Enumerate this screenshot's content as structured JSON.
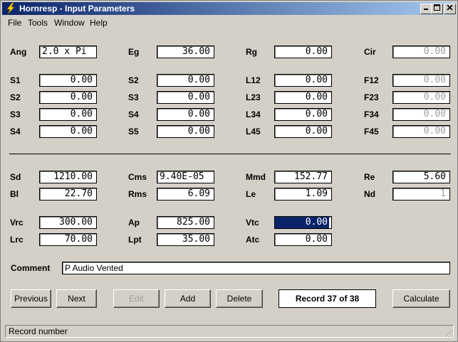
{
  "window": {
    "title": "Hornresp - Input Parameters"
  },
  "menu": [
    "File",
    "Tools",
    "Window",
    "Help"
  ],
  "rows": {
    "r1": [
      {
        "label": "Ang",
        "value": "2.0 x Pi"
      },
      {
        "label": "Eg",
        "value": "36.00"
      },
      {
        "label": "Rg",
        "value": "0.00"
      },
      {
        "label": "Cir",
        "value": "0.00"
      }
    ],
    "r2": [
      {
        "label": "S1",
        "value": "0.00"
      },
      {
        "label": "S2",
        "value": "0.00"
      },
      {
        "label": "L12",
        "value": "0.00"
      },
      {
        "label": "F12",
        "value": "0.00"
      }
    ],
    "r3": [
      {
        "label": "S2",
        "value": "0.00"
      },
      {
        "label": "S3",
        "value": "0.00"
      },
      {
        "label": "L23",
        "value": "0.00"
      },
      {
        "label": "F23",
        "value": "0.00"
      }
    ],
    "r4": [
      {
        "label": "S3",
        "value": "0.00"
      },
      {
        "label": "S4",
        "value": "0.00"
      },
      {
        "label": "L34",
        "value": "0.00"
      },
      {
        "label": "F34",
        "value": "0.00"
      }
    ],
    "r5": [
      {
        "label": "S4",
        "value": "0.00"
      },
      {
        "label": "S5",
        "value": "0.00"
      },
      {
        "label": "L45",
        "value": "0.00"
      },
      {
        "label": "F45",
        "value": "0.00"
      }
    ],
    "r6": [
      {
        "label": "Sd",
        "value": "1210.00"
      },
      {
        "label": "Cms",
        "value": "9.40E-05"
      },
      {
        "label": "Mmd",
        "value": "152.77"
      },
      {
        "label": "Re",
        "value": "5.60"
      }
    ],
    "r7": [
      {
        "label": "Bl",
        "value": "22.70"
      },
      {
        "label": "Rms",
        "value": "6.09"
      },
      {
        "label": "Le",
        "value": "1.09"
      },
      {
        "label": "Nd",
        "value": "1"
      }
    ],
    "r8": [
      {
        "label": "Vrc",
        "value": "300.00"
      },
      {
        "label": "Ap",
        "value": "825.00"
      },
      {
        "label": "Vtc",
        "value": "0.00"
      }
    ],
    "r9": [
      {
        "label": "Lrc",
        "value": "70.00"
      },
      {
        "label": "Lpt",
        "value": "35.00"
      },
      {
        "label": "Atc",
        "value": "0.00"
      }
    ]
  },
  "comment": {
    "label": "Comment",
    "value": "P Audio Vented"
  },
  "buttons": {
    "previous": "Previous",
    "next": "Next",
    "edit": "Edit",
    "add": "Add",
    "delete": "Delete",
    "calculate": "Calculate"
  },
  "record": "Record 37 of 38",
  "status": "Record number",
  "colors": {
    "titlebar_start": "#0a246a",
    "titlebar_end": "#a6caf0",
    "face": "#d4d0c8",
    "disabled_text": "#a0a0a0",
    "selection": "#0a246a"
  }
}
